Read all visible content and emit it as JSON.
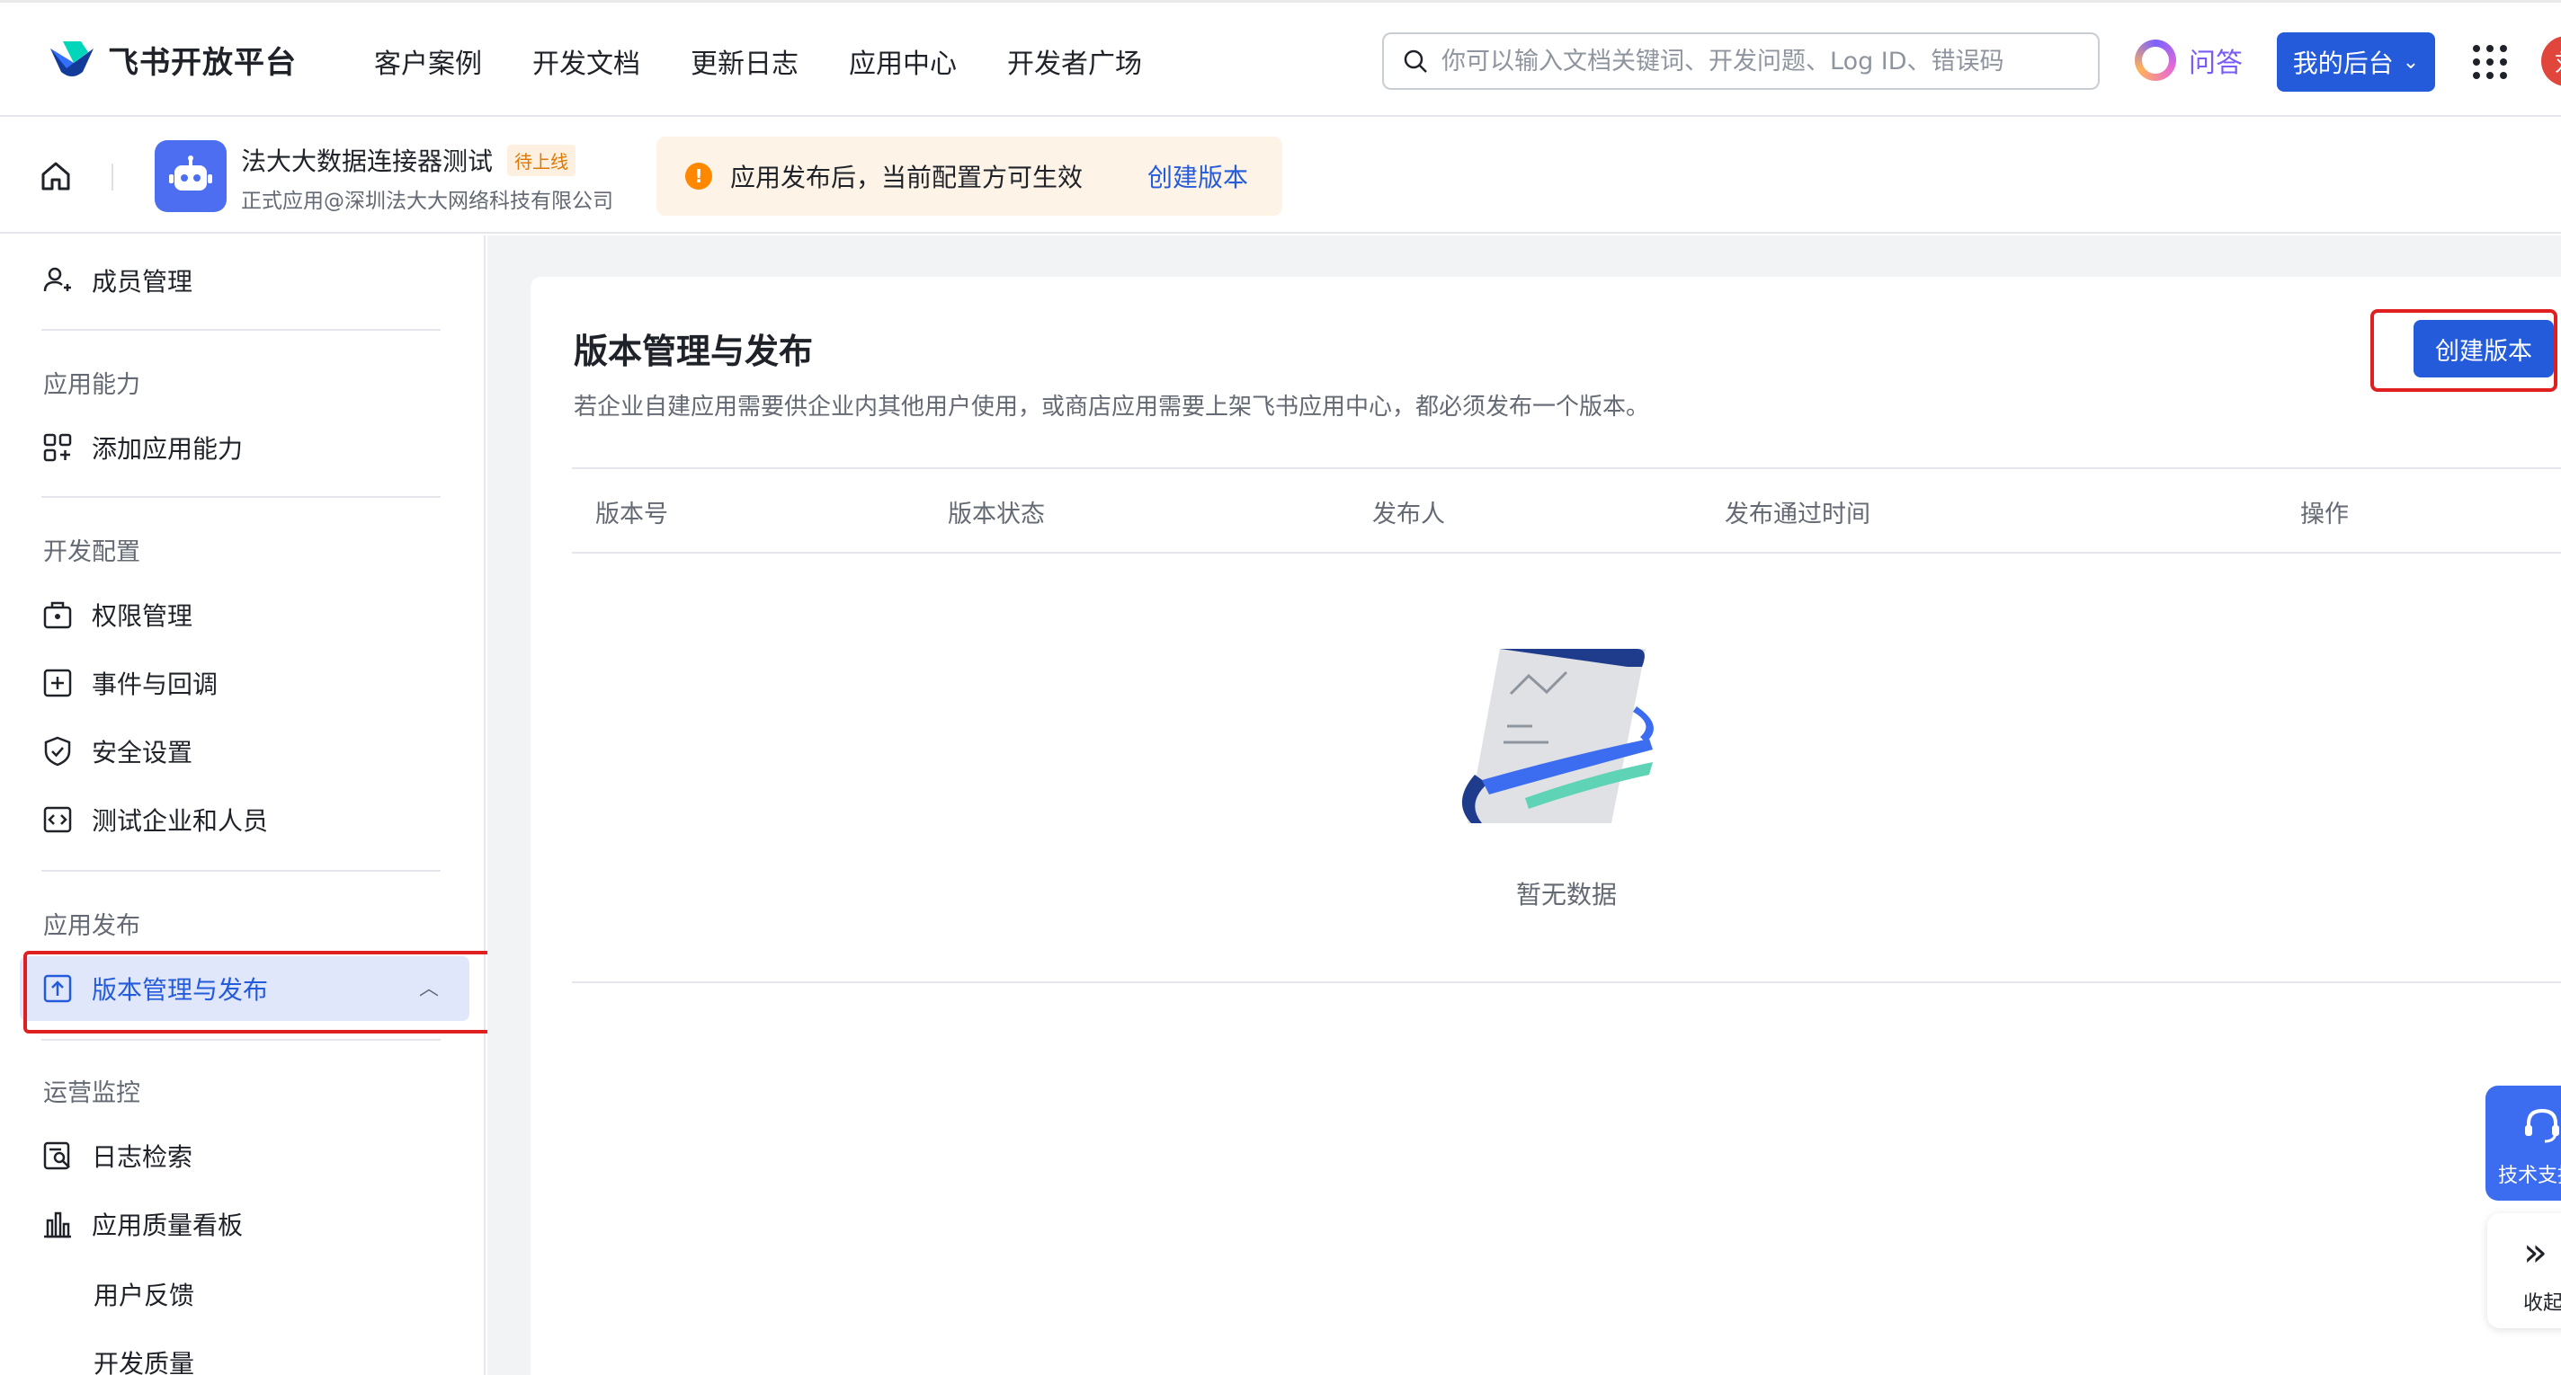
{
  "topbar": {
    "logo_text": "飞书开放平台",
    "nav": [
      "客户案例",
      "开发文档",
      "更新日志",
      "应用中心",
      "开发者广场"
    ],
    "search_placeholder": "你可以输入文档关键词、开发问题、Log ID、错误码",
    "ask_label": "问答",
    "console_label": "我的后台",
    "avatar_text": "刘"
  },
  "app": {
    "name": "法大大数据连接器测试",
    "tag": "待上线",
    "org": "正式应用@深圳法大大网络科技有限公司",
    "notice_text": "应用发布后，当前配置方可生效",
    "notice_link": "创建版本"
  },
  "sidebar": {
    "member_mgmt": "成员管理",
    "group_capability": "应用能力",
    "add_capability": "添加应用能力",
    "group_dev_config": "开发配置",
    "permissions": "权限管理",
    "events": "事件与回调",
    "security": "安全设置",
    "test_tenant": "测试企业和人员",
    "group_publish": "应用发布",
    "version_publish": "版本管理与发布",
    "group_ops": "运营监控",
    "log_search": "日志检索",
    "quality_board": "应用质量看板",
    "user_feedback": "用户反馈",
    "dev_quality": "开发质量"
  },
  "main": {
    "title": "版本管理与发布",
    "description": "若企业自建应用需要供企业内其他用户使用，或商店应用需要上架飞书应用中心，都必须发布一个版本。",
    "create_button": "创建版本",
    "columns": [
      "版本号",
      "版本状态",
      "发布人",
      "发布通过时间",
      "操作"
    ],
    "empty_text": "暂无数据"
  },
  "floating": {
    "support_label": "技术支持",
    "collapse_label": "收起"
  },
  "colors": {
    "primary": "#245bdb",
    "active_bg": "#e1e7fb",
    "highlight_red": "#e02020",
    "warning": "#ff8800"
  }
}
